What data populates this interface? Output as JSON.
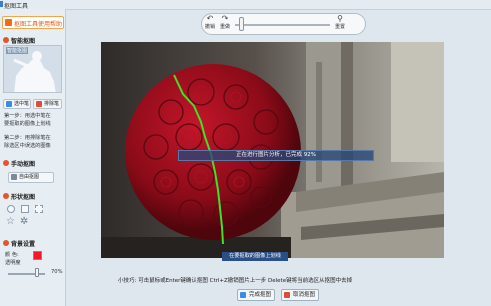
{
  "window": {
    "title": "抠图工具"
  },
  "sidebar": {
    "help_label": "抠图工具使用帮助",
    "smart": {
      "title": "智能抠图",
      "thumb_label": "智能抠图",
      "select_label": "选中笔",
      "remove_label": "排除笔",
      "step1": [
        "第一步：用选中笔在",
        "要抠取的图像上划线"
      ],
      "step2": [
        "第二步：用排除笔在",
        "除选区中误选的图像"
      ]
    },
    "manual": {
      "title": "手动抠图",
      "freehand_label": "自由抠图"
    },
    "shape": {
      "title": "形状抠图"
    },
    "background": {
      "title": "背景设置",
      "color_label": "颜 色:",
      "opacity_label": "透明度",
      "opacity_value": "70%",
      "opacity_level": 0.7,
      "swatch_color": "#f0182a"
    }
  },
  "toolbar": {
    "undo_label": "撤销",
    "redo_label": "重做",
    "reset_label": "重置"
  },
  "canvas": {
    "progress_text": "正在进行图片分析，已完成 92%",
    "tip_bubble": "在要抠取的图像上划线"
  },
  "footer": {
    "hint": "小技巧: 可击鼠标或Enter键确认抠图   Ctrl+Z撤销图片上一步   Delete键将当前选区从抠图中去掉",
    "confirm_label": "完成抠图",
    "cancel_label": "取消抠图"
  },
  "icons": {
    "help": "help-icon",
    "select": "select-brush-icon",
    "remove": "remove-brush-icon",
    "freehand": "freehand-cutout-icon",
    "undo": "undo-icon",
    "redo": "redo-icon",
    "reset": "reset-icon",
    "confirm": "confirm-icon",
    "cancel": "cancel-icon"
  },
  "colors": {
    "accent": "#f26a1b",
    "progress_bg": "#2c4e86",
    "stroke": "#3fe12a"
  }
}
